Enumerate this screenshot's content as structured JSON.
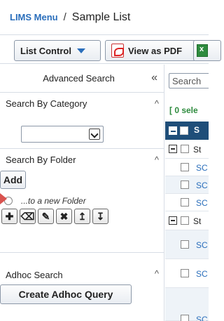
{
  "breadcrumb": {
    "menu": "LIMS Menu",
    "separator": "/",
    "title": "Sample List"
  },
  "toolbar": {
    "list_control": "List Control",
    "view_pdf": "View as PDF"
  },
  "left_panel": {
    "title": "Advanced Search",
    "collapse_glyph": "«",
    "category": {
      "title": "Search By Category",
      "toggle": "^"
    },
    "folder": {
      "title": "Search By Folder",
      "toggle": "^",
      "add": "Add",
      "new_folder": "...to a new Folder",
      "tools": [
        "✚",
        "⌫",
        "✎",
        "✖",
        "↥",
        "↧"
      ]
    },
    "adhoc": {
      "title": "Adhoc Search",
      "toggle": "^",
      "button": "Create Adhoc Query"
    }
  },
  "right_panel": {
    "search_placeholder": "Search",
    "selected": "[ 0 sele",
    "header_col": "S",
    "group1": "St",
    "group2": "St",
    "row_prefix": "SC"
  },
  "colors": {
    "accent": "#2a6ebb",
    "header": "#1f4e79",
    "selected": "#2e8b3e"
  }
}
